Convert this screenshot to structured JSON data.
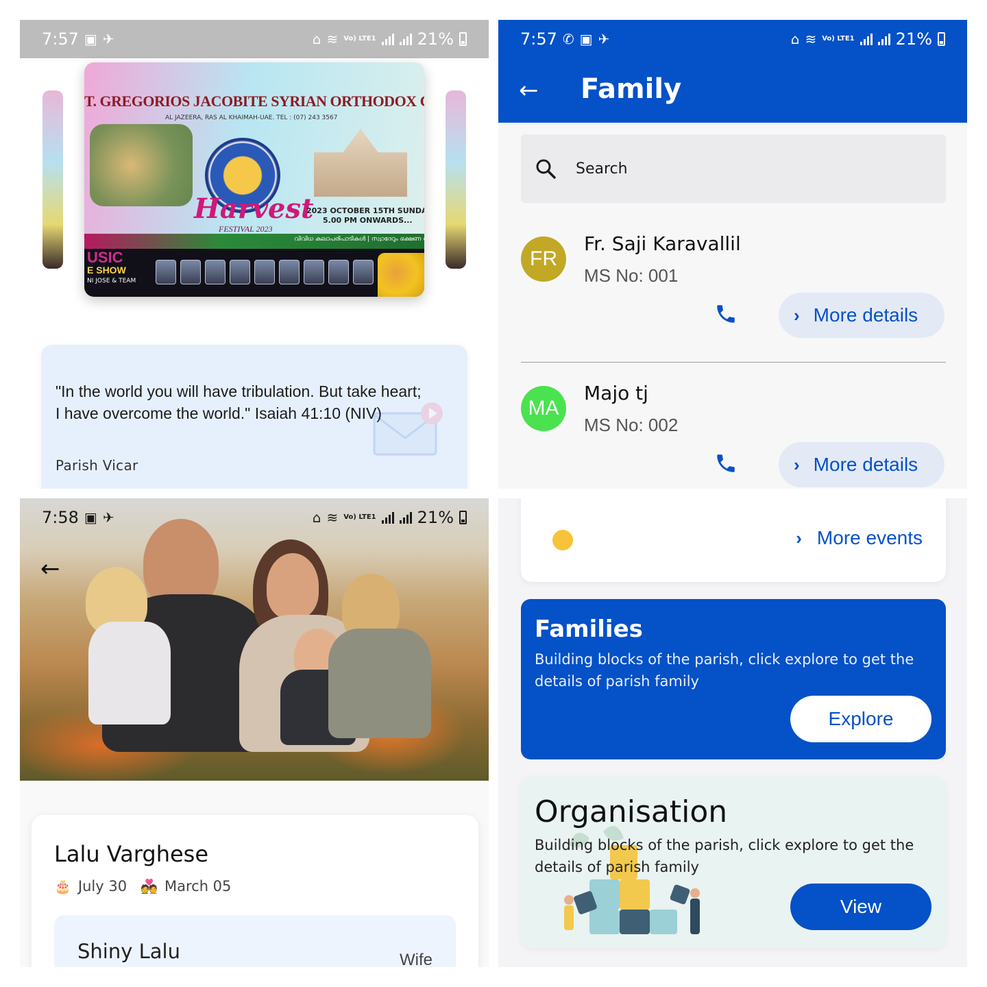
{
  "colors": {
    "primary": "#0451c8",
    "avatar_fr": "#c3a826",
    "avatar_ma": "#4be24f",
    "event_dot": "#f7c338"
  },
  "panel1": {
    "status": {
      "time": "7:57",
      "battery": "21%",
      "lte": "Vo) LTE1"
    },
    "poster": {
      "title": "T. GREGORIOS JACOBITE SYRIAN ORTHODOX CHURC",
      "address": "AL JAZEERA, RAS AL KHAIMAH-UAE. TEL : (07) 243 3567",
      "harvest": "Harvest",
      "festival": "FESTIVAL 2023",
      "date_line1": "2023 OCTOBER 15TH SUNDA",
      "date_line2": "5.00 PM ONWARDS...",
      "band": "വിവിധ കലാപരിപാടികൾ | സ്വാദേറും ഭക്ഷണ വി",
      "music1": "USIC",
      "music2": "E SHOW",
      "music3": "NI JOSE & TEAM"
    },
    "quote": {
      "text": "\"In the world you will have tribulation. But take heart; I have overcome the world.\" Isaiah 41:10 (NIV)",
      "author": "Parish Vicar",
      "icon": "mail-icon"
    }
  },
  "panel2": {
    "status": {
      "time": "7:57",
      "battery": "21%",
      "lte": "Vo) LTE1"
    },
    "title": "Family",
    "search": {
      "placeholder": "Search",
      "icon": "search-icon"
    },
    "members": [
      {
        "initials": "FR",
        "name": "Fr. Saji Karavallil",
        "ms": "MS No: 001",
        "more": "More details"
      },
      {
        "initials": "MA",
        "name": "Majo tj",
        "ms": "MS No: 002",
        "more": "More details"
      }
    ]
  },
  "panel3": {
    "status": {
      "time": "7:58",
      "battery": "21%",
      "lte": "Vo) LTE1"
    },
    "profile": {
      "name": "Lalu Varghese",
      "birthday": "July 30",
      "anniversary": "March 05",
      "spouse": {
        "name": "Shiny Lalu",
        "relation": "Wife"
      }
    }
  },
  "panel4": {
    "events": {
      "more": "More events"
    },
    "families": {
      "title": "Families",
      "desc": "Building blocks of the parish, click explore to get the details of parish family",
      "button": "Explore"
    },
    "organisation": {
      "title": "Organisation",
      "desc": "Building blocks of the parish, click explore to get the details of parish family",
      "button": "View"
    }
  }
}
